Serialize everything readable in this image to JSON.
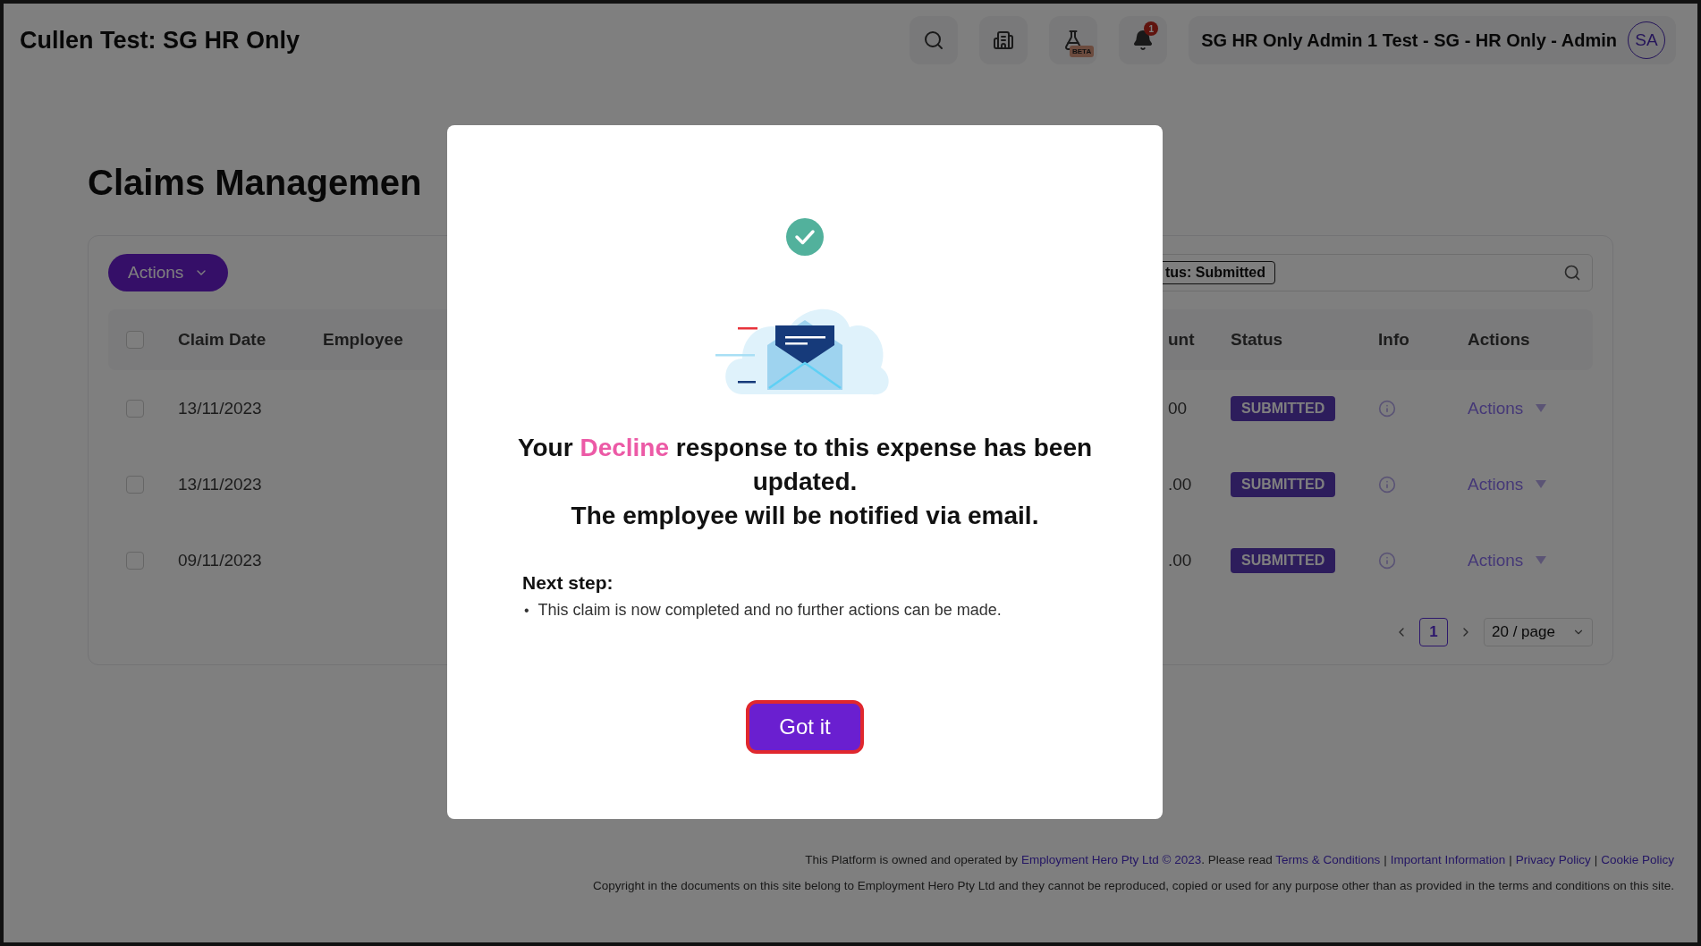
{
  "header": {
    "title": "Cullen Test: SG HR Only",
    "icon_buttons": [
      {
        "kind": "search"
      },
      {
        "kind": "building"
      },
      {
        "kind": "beta",
        "badge": "BETA"
      },
      {
        "kind": "notifications",
        "badge": "1"
      }
    ],
    "user": {
      "name": "SG HR Only Admin 1 Test - SG - HR Only - Admin",
      "initials": "SA"
    }
  },
  "page": {
    "heading": "Claims Managemen",
    "actions_button": "Actions",
    "filter": {
      "tag": "tus: Submitted"
    },
    "table": {
      "select_all": {
        "checked": false
      },
      "columns": [
        "Claim Date",
        "Employee",
        "unt",
        "Status",
        "Info",
        "Actions"
      ],
      "rows": [
        {
          "checked": false,
          "claim_date": "13/11/2023",
          "amount": "00",
          "status": "SUBMITTED",
          "actions": "Actions"
        },
        {
          "checked": false,
          "claim_date": "13/11/2023",
          "amount": ".00",
          "status": "SUBMITTED",
          "actions": "Actions"
        },
        {
          "checked": false,
          "claim_date": "09/11/2023",
          "amount": ".00",
          "status": "SUBMITTED",
          "actions": "Actions"
        }
      ]
    },
    "pagination": {
      "pages": [
        {
          "label": "1",
          "selected": true
        }
      ],
      "page_size": "20 / page"
    }
  },
  "modal": {
    "message_before": "Your",
    "highlight": "Decline",
    "message_after": "response to this expense has been updated.",
    "notice": "The employee will be notified via email.",
    "next_step_title": "Next step:",
    "next_steps": [
      {
        "bullet": "•",
        "text": "This claim is now completed and no further actions can be made."
      }
    ],
    "button": "Got it"
  },
  "footer": {
    "intro": "This Platform is owned and operated by",
    "owner_link": "Employment Hero Pty Ltd © 2023",
    "read_text": ". Please read",
    "links": [
      {
        "label": "Terms & Conditions"
      },
      {
        "separator": "|",
        "label": "Important Information"
      },
      {
        "separator": "|",
        "label": "Privacy Policy"
      },
      {
        "separator": "|",
        "label": "Cookie Policy"
      }
    ],
    "copyright": "Copyright in the documents on this site belong to Employment Hero Pty Ltd and they cannot be reproduced, copied or used for any purpose other than as provided in the terms and conditions on this site."
  }
}
